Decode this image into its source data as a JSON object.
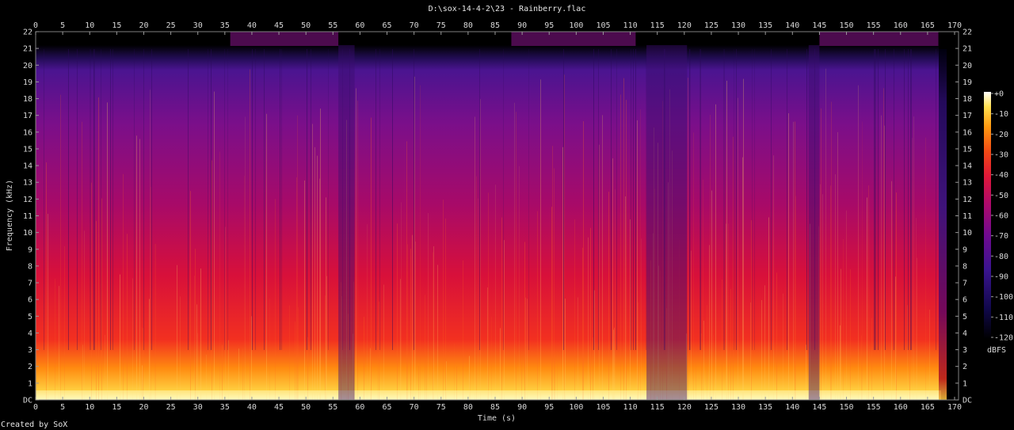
{
  "window": {
    "title": "D:\\sox-14-4-2\\23 - Rainberry.flac",
    "credit": "Created by SoX"
  },
  "chart_data": {
    "type": "heatmap",
    "title": "D:\\sox-14-4-2\\23 - Rainberry.flac",
    "xlabel": "Time (s)",
    "ylabel": "Frequency (kHz)",
    "xlim": [
      0,
      170
    ],
    "ylim": [
      0,
      22
    ],
    "x_ticks": [
      0,
      5,
      10,
      15,
      20,
      25,
      30,
      35,
      40,
      45,
      50,
      55,
      60,
      65,
      70,
      75,
      80,
      85,
      90,
      95,
      100,
      105,
      110,
      115,
      120,
      125,
      130,
      135,
      140,
      145,
      150,
      155,
      160,
      165,
      170
    ],
    "y_ticks": [
      "DC",
      "1",
      "2",
      "3",
      "4",
      "5",
      "6",
      "7",
      "8",
      "9",
      "10",
      "11",
      "12",
      "13",
      "14",
      "15",
      "16",
      "17",
      "18",
      "19",
      "20",
      "21",
      "22"
    ],
    "colorbar": {
      "label": "dBFS",
      "ticks": [
        "+0",
        "-10",
        "-20",
        "-30",
        "-40",
        "-50",
        "-60",
        "-70",
        "-80",
        "-90",
        "-100",
        "-110",
        "-120"
      ],
      "range": [
        -120,
        0
      ]
    },
    "colors": {
      "background": "#000000",
      "low": "#00003a",
      "mid_low": "#5a1a9e",
      "mid": "#b0106a",
      "mid_high": "#e8202a",
      "high": "#ff9a10",
      "peak": "#ffffc8"
    },
    "audio_end_s": 167.5
  }
}
